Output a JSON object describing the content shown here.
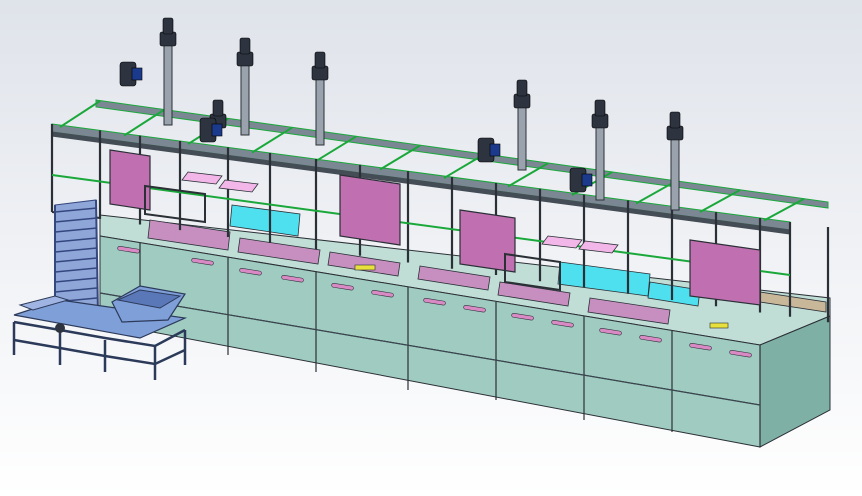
{
  "view": {
    "background_top": "#dfe3ea",
    "background_bottom": "#ffffff"
  },
  "colors": {
    "cabinet_front": "#9fcbc0",
    "cabinet_side": "#7fb0a6",
    "cabinet_top": "#c0ddd6",
    "frame_rail": "#7c8794",
    "frame_rail_dark": "#444c55",
    "frame_edge_green": "#1aa83a",
    "post_edge_dark": "#2b3036",
    "lift_column": "#9aa3ad",
    "motor_dark": "#2d3440",
    "motor_blue": "#1c3a8c",
    "tank_magenta": "#c78fc0",
    "tank_cyan": "#4fe0ef",
    "tray_pink": "#f2b6e8",
    "basket_pink": "#c06fb0",
    "yellow_marker": "#e8e03c",
    "slot_pink": "#d98ac4",
    "conveyor_blue": "#8fa6d8",
    "conveyor_edge": "#34477f",
    "hopper_blue": "#7f9fd8",
    "stand_frame": "#2c3a5a",
    "bed_tan": "#c9b79a"
  },
  "icons": {
    "lift_motor": "gearmotor-icon",
    "drive_motor": "motor-icon"
  },
  "machine": {
    "lift_count": 7,
    "drive_motor_count": 4,
    "cabinet_modules": 8
  }
}
